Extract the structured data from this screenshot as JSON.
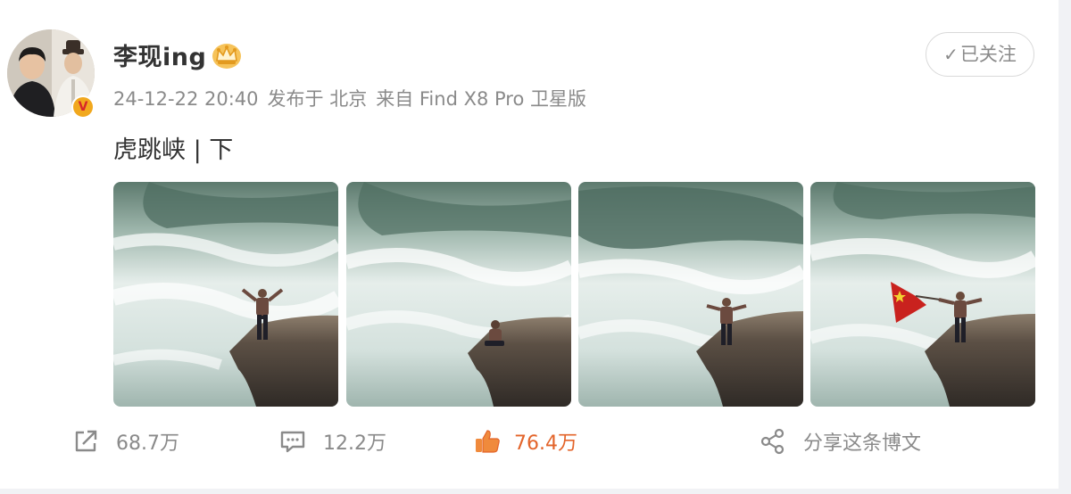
{
  "post": {
    "author": "李现ing",
    "badge_letter": "V",
    "follow_label": "已关注",
    "timestamp": "24-12-22 20:40",
    "location": "发布于 北京",
    "source": "来自 Find X8 Pro 卫星版",
    "text": "虎跳峡 | 下"
  },
  "photos": [
    {
      "pose": "arms-spread"
    },
    {
      "pose": "sitting"
    },
    {
      "pose": "arms-spread"
    },
    {
      "pose": "holding-flag"
    }
  ],
  "actions": {
    "forward_count": "68.7万",
    "comment_count": "12.2万",
    "like_count": "76.4万",
    "share_label": "分享这条博文"
  },
  "colors": {
    "like_accent": "#e3642a",
    "muted_text": "#8a8a8a",
    "badge": "#f1a81e"
  }
}
